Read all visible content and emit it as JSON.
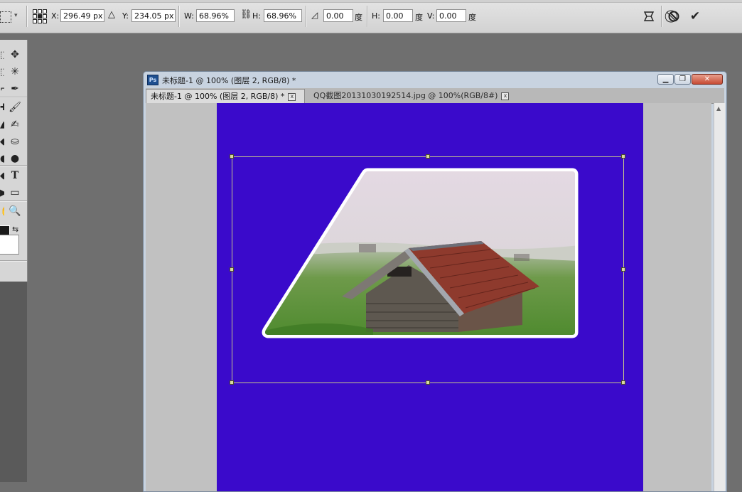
{
  "options": {
    "x_label": "X:",
    "x_value": "296.49 px",
    "y_label": "Y:",
    "y_value": "234.05 px",
    "w_label": "W:",
    "w_value": "68.96%",
    "h_label": "H:",
    "h_value": "68.96%",
    "angle_value": "0.00",
    "angle_unit": "度",
    "hskew_label": "H:",
    "hskew_value": "0.00",
    "hskew_unit": "度",
    "vskew_label": "V:",
    "vskew_value": "0.00",
    "vskew_unit": "度",
    "icons": [
      "transform-reference-point-icon",
      "delta-icon",
      "link-icon",
      "angle-icon",
      "warp-icon",
      "cancel-icon",
      "commit-icon"
    ]
  },
  "document": {
    "title": "未标题-1 @ 100% (图层 2, RGB/8) *",
    "tabs": [
      {
        "label": "未标题-1 @ 100% (图层 2, RGB/8) *"
      },
      {
        "label": "QQ截图20131030192514.jpg @ 100%(RGB/8#)"
      }
    ],
    "canvas_color": "#3a0acb"
  },
  "colors": {
    "foreground": "#1a1a1a",
    "background": "#ffffff"
  }
}
